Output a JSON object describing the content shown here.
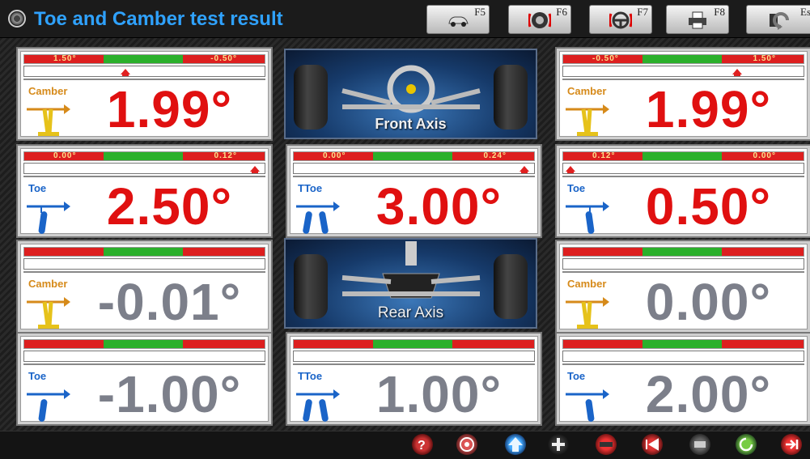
{
  "title": "Toe and Camber test result",
  "fkeys": [
    {
      "label": "F5",
      "icon": "car-icon"
    },
    {
      "label": "F6",
      "icon": "wheel-icon"
    },
    {
      "label": "F7",
      "icon": "steering-wheel-icon"
    },
    {
      "label": "F8",
      "icon": "printer-icon"
    },
    {
      "label": "Es",
      "icon": "back-icon"
    }
  ],
  "front": {
    "left_camber": {
      "label": "Camber",
      "value": "1.99°",
      "min": "1.50°",
      "max": "-0.50°"
    },
    "right_camber": {
      "label": "Camber",
      "value": "1.99°",
      "min": "-0.50°",
      "max": "1.50°"
    },
    "left_toe": {
      "label": "Toe",
      "value": "2.50°",
      "min": "0.00°",
      "max": "0.12°"
    },
    "total_toe": {
      "label": "TToe",
      "value": "3.00°",
      "min": "0.00°",
      "max": "0.24°"
    },
    "right_toe": {
      "label": "Toe",
      "value": "0.50°",
      "min": "0.12°",
      "max": "0.00°"
    },
    "axis_label": "Front Axis"
  },
  "rear": {
    "left_camber": {
      "label": "Camber",
      "value": "-0.01°"
    },
    "right_camber": {
      "label": "Camber",
      "value": "0.00°"
    },
    "left_toe": {
      "label": "Toe",
      "value": "-1.00°"
    },
    "total_toe": {
      "label": "TToe",
      "value": "1.00°"
    },
    "right_toe": {
      "label": "Toe",
      "value": "2.00°"
    },
    "axis_label": "Rear Axis"
  },
  "colors": {
    "title": "#2fa2ff",
    "in_range": "#2bb02b",
    "out_range": "#dd1f1f",
    "value_active": "#e01010",
    "value_inactive": "#7c7f8a"
  },
  "bottom_buttons": [
    {
      "icon": "help-icon",
      "key": "F1"
    },
    {
      "icon": "target-icon",
      "key": "F2"
    },
    {
      "icon": "up-arrow-icon"
    },
    {
      "icon": "plus-icon",
      "key": "F4"
    },
    {
      "icon": "steering-lock-icon"
    },
    {
      "icon": "first-page-icon"
    },
    {
      "icon": "car-lift-icon"
    },
    {
      "icon": "refresh-icon"
    },
    {
      "icon": "next-icon"
    }
  ]
}
